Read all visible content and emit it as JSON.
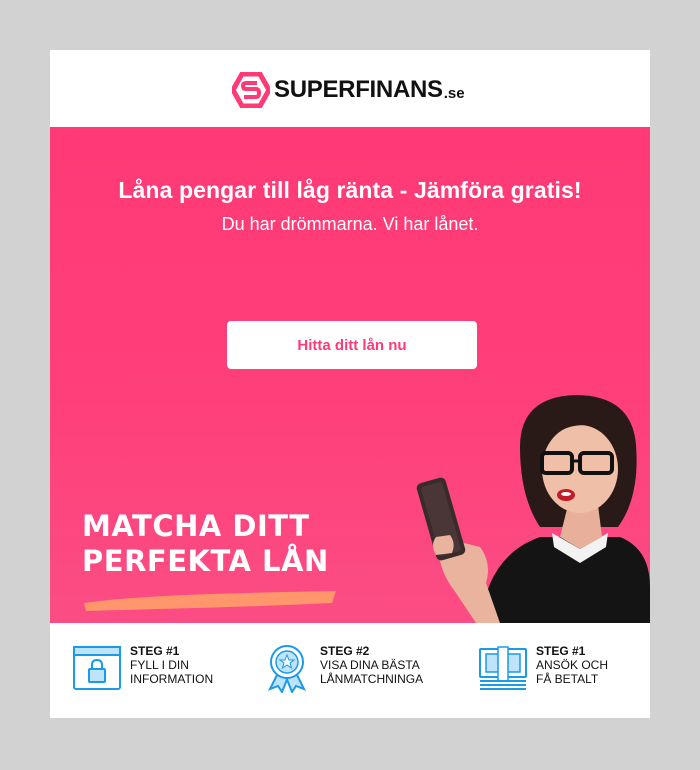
{
  "brand": {
    "name": "SUPERFINANS",
    "tld": ".se",
    "colors": {
      "primary": "#ff3a76",
      "dark": "#111111",
      "accent_brush": "#ff9a6a",
      "icon_blue": "#1a9be8"
    }
  },
  "hero": {
    "title": "Låna pengar till låg ränta - Jämföra gratis!",
    "subtitle": "Du har drömmarna. Vi har lånet.",
    "cta_label": "Hitta ditt lån nu",
    "headline_line1": "MATCHA DITT",
    "headline_line2": "PERFEKTA LÅN"
  },
  "steps": [
    {
      "number": "STEG #1",
      "line1": "FYLL I DIN",
      "line2": "INFORMATION",
      "icon": "form-lock-icon"
    },
    {
      "number": "STEG #2",
      "line1": "VISA DINA BÄSTA",
      "line2": "LÅNMATCHNINGA",
      "icon": "award-ribbon-icon"
    },
    {
      "number": "STEG #1",
      "line1": "ANSÖK OCH",
      "line2": "FÅ BETALT",
      "icon": "money-stack-icon"
    }
  ]
}
